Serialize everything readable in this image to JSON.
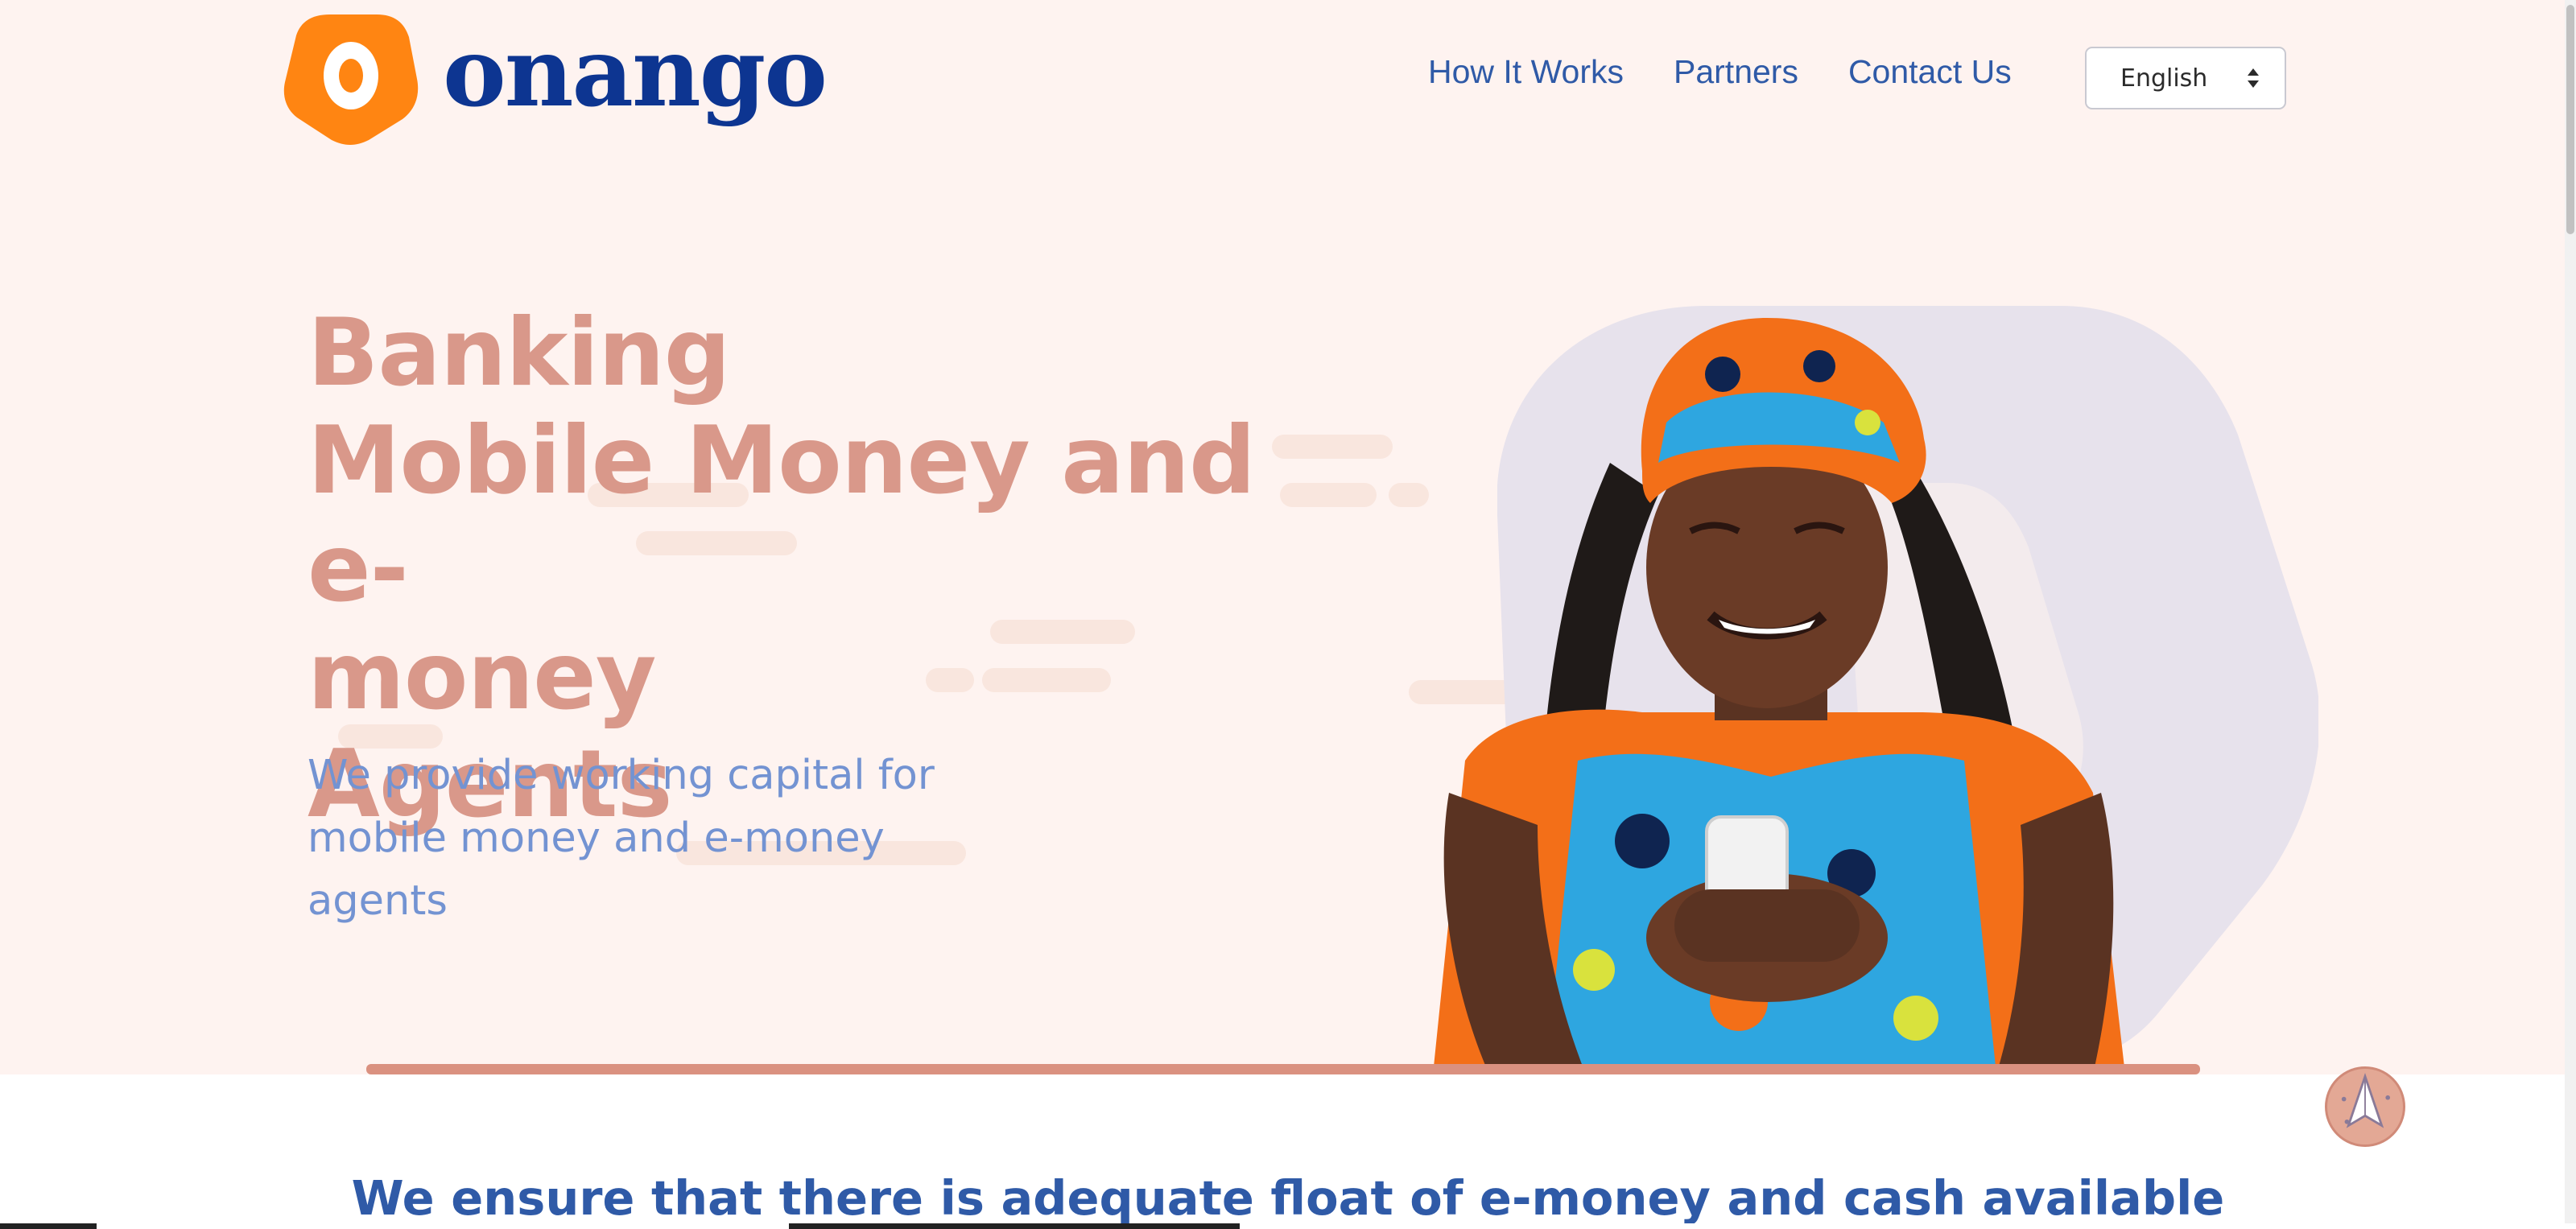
{
  "brand": {
    "name": "onango",
    "primary_color": "#0d3591",
    "accent_color": "#ff8512",
    "hero_bg": "#fef3f0"
  },
  "nav": {
    "items": [
      {
        "label": "How It Works"
      },
      {
        "label": "Partners"
      },
      {
        "label": "Contact Us"
      }
    ],
    "language": {
      "selected": "English"
    }
  },
  "hero": {
    "headline_lines": [
      "Banking",
      "Mobile Money and e-",
      "money",
      "Agents"
    ],
    "subline_lines": [
      "We provide working capital for",
      "mobile money and e-money",
      "agents"
    ]
  },
  "tagline": "We ensure that there is adequate float of e-money and cash available",
  "icons": {
    "language_select": "chevron-updown-icon",
    "back_to_top": "paper-plane-icon"
  }
}
